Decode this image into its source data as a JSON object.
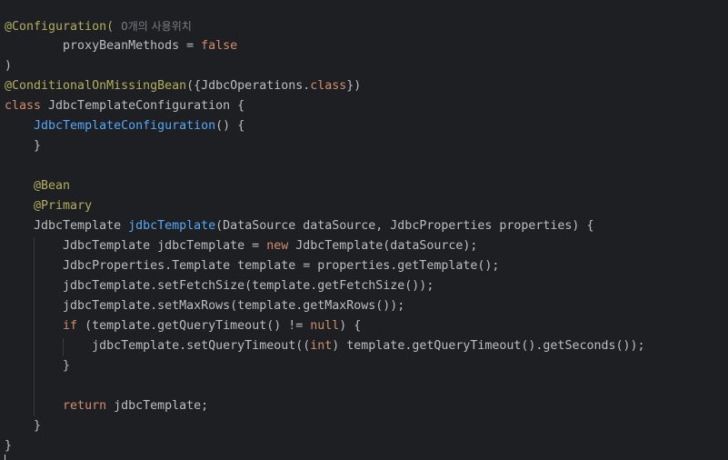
{
  "editor": {
    "usage_hint": "0개의 사용위치",
    "lines": {
      "l1_ann": "@Configuration(",
      "l2_indent": "        ",
      "l2_param": "proxyBeanMethods = ",
      "l2_value": "false",
      "l3": ")",
      "l4_ann": "@ConditionalOnMissingBean",
      "l4_a": "({JdbcOperations.",
      "l4_kw": "class",
      "l4_b": "})",
      "l5_kw": "class",
      "l5_rest": " JdbcTemplateConfiguration {",
      "l6_indent": "    ",
      "l6_fn": "JdbcTemplateConfiguration",
      "l6_rest": "() {",
      "l7": "    }",
      "l9_indent": "    ",
      "l9_ann": "@Bean",
      "l10_indent": "    ",
      "l10_ann": "@Primary",
      "l11_a": "    JdbcTemplate ",
      "l11_fn": "jdbcTemplate",
      "l11_b": "(DataSource dataSource, JdbcProperties properties) {",
      "l12_a": "        JdbcTemplate jdbcTemplate = ",
      "l12_kw": "new",
      "l12_b": " JdbcTemplate(dataSource);",
      "l13": "        JdbcProperties.Template template = properties.getTemplate();",
      "l14": "        jdbcTemplate.setFetchSize(template.getFetchSize());",
      "l15": "        jdbcTemplate.setMaxRows(template.getMaxRows());",
      "l16_indent": "        ",
      "l16_kw": "if",
      "l16_a": " (template.getQueryTimeout() != ",
      "l16_kw2": "null",
      "l16_b": ") {",
      "l17_a": "            jdbcTemplate.setQueryTimeout((",
      "l17_kw": "int",
      "l17_b": ") template.getQueryTimeout().getSeconds());",
      "l18": "        }",
      "l20_indent": "        ",
      "l20_kw": "return",
      "l20_rest": " jdbcTemplate;",
      "l21": "    }",
      "l22": "}"
    }
  },
  "colors": {
    "background": "#1e1f22",
    "default_text": "#bcbec4",
    "annotation": "#b3ae60",
    "keyword": "#cf8e6d",
    "method_declaration": "#56a8f5",
    "inlay_hint": "#7a7e85"
  }
}
